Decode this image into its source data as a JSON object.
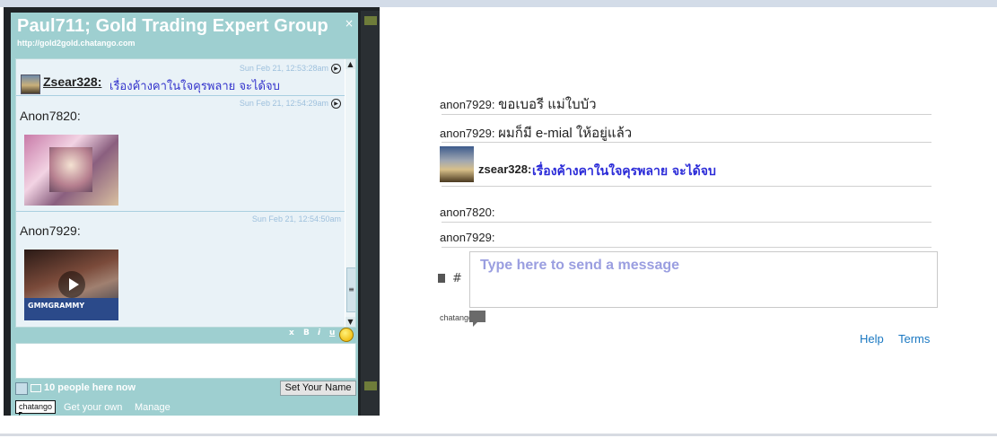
{
  "widget": {
    "title": "Paul711;  Gold Trading Expert Group",
    "close_icon": "×",
    "url": "http://gold2gold.chatango.com",
    "messages": [
      {
        "time": "Sun Feb 21, 12:53:28am",
        "user": "Zsear328:",
        "text": "เรื่องค้างคาในใจคุรพลาย จะได้จบ"
      },
      {
        "time": "Sun Feb 21, 12:54:29am",
        "user": "Anon7820:"
      },
      {
        "time": "Sun Feb 21, 12:54:50am",
        "user": "Anon7929:",
        "thumb_label": "GMMGRAMMY"
      }
    ],
    "format_buttons": [
      "x",
      "B",
      "i",
      "u"
    ],
    "people_count": "10 people here now",
    "set_name_label": "Set Your Name",
    "logo_text": "chatango",
    "get_own_label": "Get your own",
    "manage_label": "Manage",
    "scroll_up": "▲",
    "scroll_down": "▼",
    "scroll_thumb": "≡"
  },
  "right": {
    "messages": [
      {
        "user": "anon7929:",
        "text": "ขอเบอรี แม่ใบบัว"
      },
      {
        "user": "anon7929:",
        "text": "ผมก็มี e-mial ให้อยู่แล้ว"
      },
      {
        "user": "zsear328:",
        "text": "เรื่องค้างคาในใจคุรพลาย จะได้จบ"
      },
      {
        "user": "anon7820:",
        "text": ""
      },
      {
        "user": "anon7929:",
        "text": ""
      }
    ],
    "input_placeholder": "Type here to send a message",
    "hash_label": "#",
    "chatango_label": "chatango",
    "help_label": "Help",
    "terms_label": "Terms"
  }
}
